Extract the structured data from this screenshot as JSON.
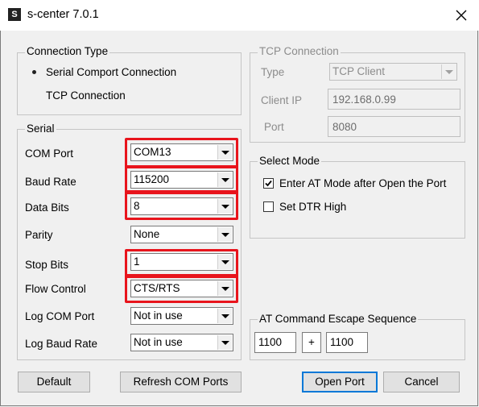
{
  "window": {
    "title": "s-center 7.0.1",
    "app_icon_letter": "S"
  },
  "connection_type": {
    "legend": "Connection Type",
    "options": [
      {
        "label": "Serial Comport Connection",
        "selected": true
      },
      {
        "label": "TCP Connection",
        "selected": false
      }
    ]
  },
  "tcp": {
    "legend": "TCP Connection",
    "type_label": "Type",
    "type_value": "TCP Client",
    "ip_label": "Client IP",
    "ip_value": "192.168.0.99",
    "port_label": "Port",
    "port_value": "8080"
  },
  "serial": {
    "legend": "Serial",
    "fields": [
      {
        "label": "COM Port",
        "value": "COM13",
        "highlighted": true
      },
      {
        "label": "Baud Rate",
        "value": "115200",
        "highlighted": true
      },
      {
        "label": "Data Bits",
        "value": "8",
        "highlighted": true
      },
      {
        "label": "Parity",
        "value": "None",
        "highlighted": false
      },
      {
        "label": "Stop Bits",
        "value": "1",
        "highlighted": true
      },
      {
        "label": "Flow Control",
        "value": "CTS/RTS",
        "highlighted": true
      },
      {
        "label": "Log COM Port",
        "value": "Not in use",
        "highlighted": false
      },
      {
        "label": "Log Baud Rate",
        "value": "Not in use",
        "highlighted": false
      }
    ]
  },
  "select_mode": {
    "legend": "Select Mode",
    "options": [
      {
        "label": "Enter AT Mode after Open the Port",
        "checked": true
      },
      {
        "label": "Set DTR High",
        "checked": false
      }
    ]
  },
  "escape": {
    "legend": "AT Command Escape Sequence",
    "first": "1100",
    "plus": "+",
    "second": "1100"
  },
  "buttons": {
    "default": "Default",
    "refresh": "Refresh COM Ports",
    "open": "Open Port",
    "cancel": "Cancel"
  },
  "colors": {
    "highlight": "#e8141c",
    "focus_border": "#0078d7"
  }
}
